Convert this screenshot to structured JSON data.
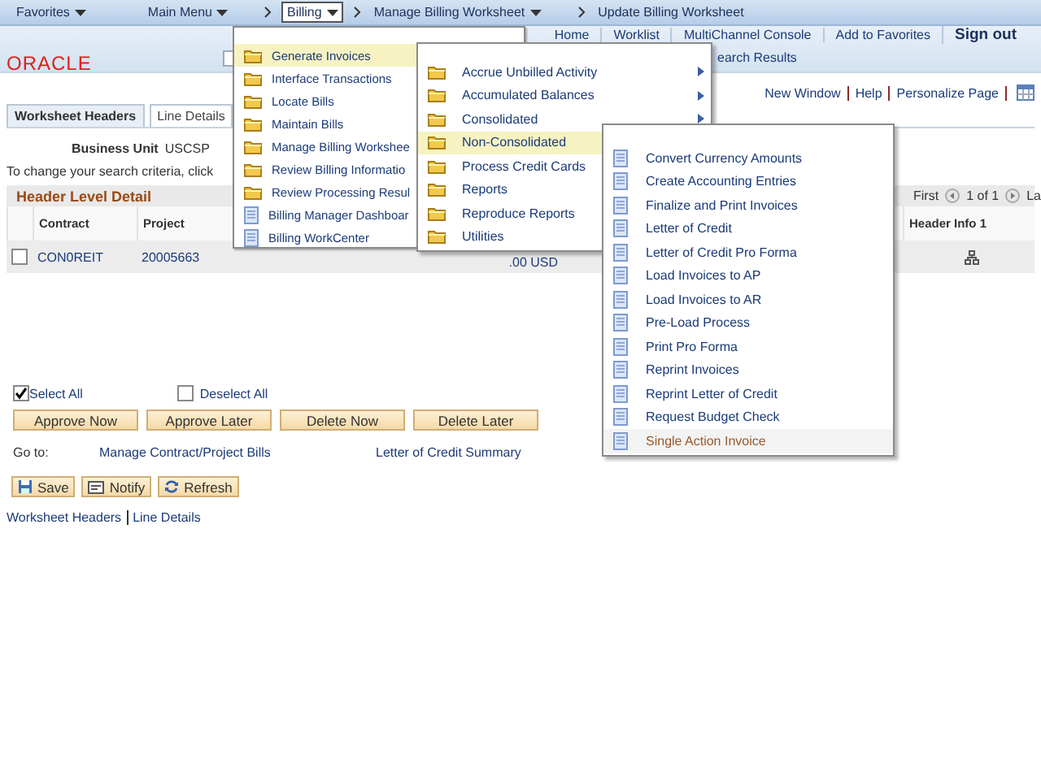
{
  "nav_bar": [
    {
      "label": "Favorites",
      "dropdown": true,
      "separator_before": false,
      "selected": false
    },
    {
      "label": "Main Menu",
      "dropdown": true,
      "separator_before": false,
      "selected": false
    },
    {
      "label": "Billing",
      "dropdown": true,
      "separator_before": true,
      "selected": true
    },
    {
      "label": "Manage Billing Worksheet",
      "dropdown": true,
      "separator_before": true,
      "selected": false
    },
    {
      "label": "Update Billing Worksheet",
      "dropdown": false,
      "separator_before": true,
      "selected": false
    }
  ],
  "header": {
    "logo": "ORACLE",
    "links": [
      {
        "label": "Home",
        "bold": false
      },
      {
        "label": "Worklist",
        "bold": false
      },
      {
        "label": "MultiChannel Console",
        "bold": false
      },
      {
        "label": "Add to Favorites",
        "bold": false
      },
      {
        "label": "Sign out",
        "bold": true
      }
    ],
    "search_results": "earch Results"
  },
  "page_links": [
    "New Window",
    "Help",
    "Personalize Page"
  ],
  "tabs": [
    {
      "label": "Worksheet Headers",
      "selected": true
    },
    {
      "label": "Line Details",
      "selected": false
    }
  ],
  "business_unit": {
    "label": "Business Unit",
    "value": "USCSP"
  },
  "instructions": "To change your search criteria, click",
  "grid": {
    "title": "Header Level Detail",
    "pager": {
      "first": "First",
      "count": "1 of 1",
      "last": "La"
    },
    "columns": [
      "Contract",
      "Project",
      "Header Info 1"
    ],
    "rows": [
      {
        "checked": false,
        "contract": "CON0REIT",
        "project": "20005663",
        "amount": ".00 USD"
      }
    ]
  },
  "select_all": {
    "label": "Select All",
    "checked": true
  },
  "deselect_all": {
    "label": "Deselect All",
    "checked": false
  },
  "action_buttons": [
    "Approve Now",
    "Approve Later",
    "Delete Now",
    "Delete Later"
  ],
  "go_to": {
    "label": "Go to:",
    "links": [
      "Manage Contract/Project Bills",
      "Letter of Credit Summary"
    ]
  },
  "toolbar": [
    {
      "label": "Save",
      "kind": "save"
    },
    {
      "label": "Notify",
      "kind": "notify"
    },
    {
      "label": "Refresh",
      "kind": "refresh"
    }
  ],
  "bottom_links": [
    "Worksheet Headers",
    "Line Details"
  ],
  "menus": [
    {
      "items": [
        {
          "label": "Generate Invoices",
          "kind": "folder",
          "selected": true,
          "arrow": false
        },
        {
          "label": "Interface Transactions",
          "kind": "folder",
          "selected": false,
          "arrow": false
        },
        {
          "label": "Locate Bills",
          "kind": "folder",
          "selected": false,
          "arrow": false
        },
        {
          "label": "Maintain Bills",
          "kind": "folder",
          "selected": false,
          "arrow": false
        },
        {
          "label": "Manage Billing Workshee",
          "kind": "folder",
          "selected": false,
          "arrow": false
        },
        {
          "label": "Review Billing Informatio",
          "kind": "folder",
          "selected": false,
          "arrow": false
        },
        {
          "label": "Review Processing Resul",
          "kind": "folder",
          "selected": false,
          "arrow": false
        },
        {
          "label": "Billing Manager Dashboar",
          "kind": "page",
          "selected": false,
          "arrow": false
        },
        {
          "label": "Billing WorkCenter",
          "kind": "page",
          "selected": false,
          "arrow": false
        }
      ]
    },
    {
      "items": [
        {
          "label": "Accrue Unbilled Activity",
          "kind": "folder",
          "selected": false,
          "arrow": true
        },
        {
          "label": "Accumulated Balances",
          "kind": "folder",
          "selected": false,
          "arrow": true
        },
        {
          "label": "Consolidated",
          "kind": "folder",
          "selected": false,
          "arrow": true
        },
        {
          "label": "Non-Consolidated",
          "kind": "folder",
          "selected": true,
          "arrow": false
        },
        {
          "label": "Process Credit Cards",
          "kind": "folder",
          "selected": false,
          "arrow": false
        },
        {
          "label": "Reports",
          "kind": "folder",
          "selected": false,
          "arrow": false
        },
        {
          "label": "Reproduce Reports",
          "kind": "folder",
          "selected": false,
          "arrow": false
        },
        {
          "label": "Utilities",
          "kind": "folder",
          "selected": false,
          "arrow": false
        }
      ]
    },
    {
      "items": [
        {
          "label": "Convert Currency Amounts",
          "kind": "page",
          "selected": false,
          "arrow": false
        },
        {
          "label": "Create Accounting Entries",
          "kind": "page",
          "selected": false,
          "arrow": false
        },
        {
          "label": "Finalize and Print Invoices",
          "kind": "page",
          "selected": false,
          "arrow": false
        },
        {
          "label": "Letter of Credit",
          "kind": "page",
          "selected": false,
          "arrow": false
        },
        {
          "label": "Letter of Credit Pro Forma",
          "kind": "page",
          "selected": false,
          "arrow": false
        },
        {
          "label": "Load Invoices to AP",
          "kind": "page",
          "selected": false,
          "arrow": false
        },
        {
          "label": "Load Invoices to AR",
          "kind": "page",
          "selected": false,
          "arrow": false
        },
        {
          "label": "Pre-Load Process",
          "kind": "page",
          "selected": false,
          "arrow": false
        },
        {
          "label": "Print Pro Forma",
          "kind": "page",
          "selected": false,
          "arrow": false
        },
        {
          "label": "Reprint Invoices",
          "kind": "page",
          "selected": false,
          "arrow": false
        },
        {
          "label": "Reprint Letter of Credit",
          "kind": "page",
          "selected": false,
          "arrow": false
        },
        {
          "label": "Request Budget Check",
          "kind": "page",
          "selected": false,
          "arrow": false
        },
        {
          "label": "Single Action Invoice",
          "kind": "page",
          "selected": true,
          "arrow": false
        }
      ]
    }
  ]
}
